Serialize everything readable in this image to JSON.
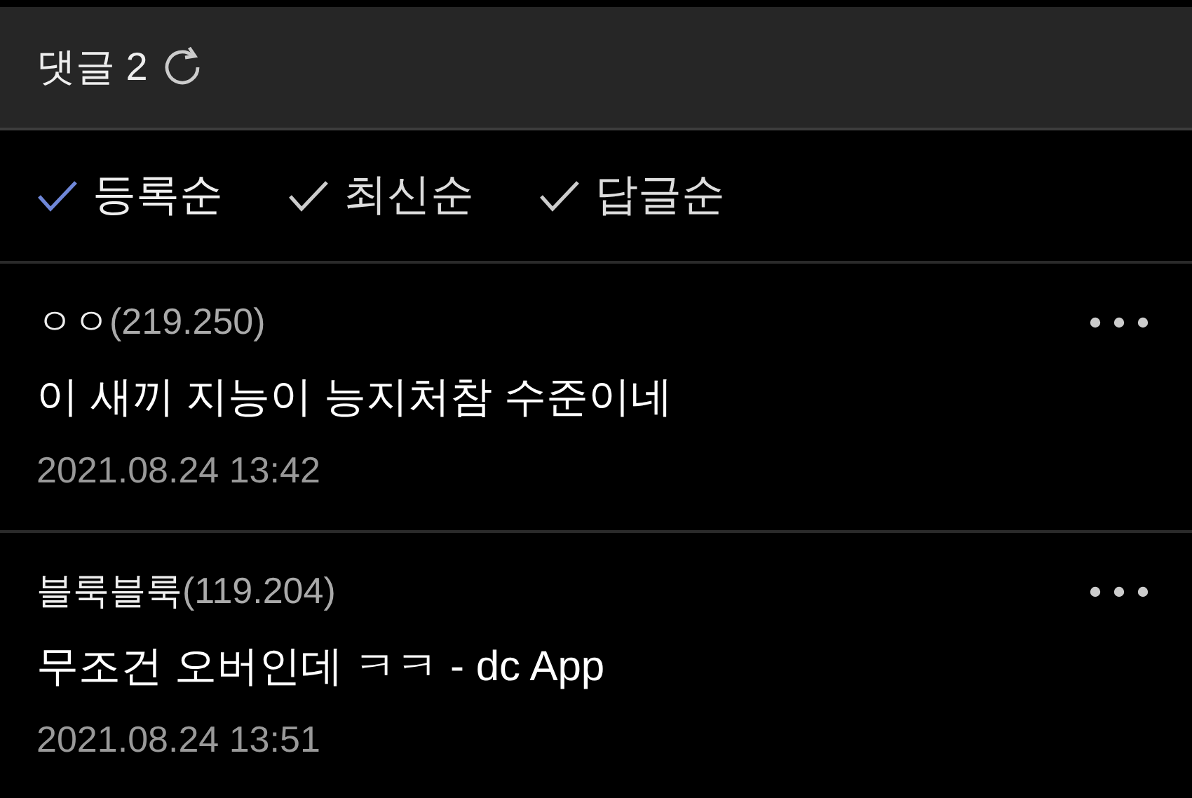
{
  "header": {
    "title": "댓글 2"
  },
  "sort_options": [
    {
      "label": "등록순",
      "selected": true
    },
    {
      "label": "최신순",
      "selected": false
    },
    {
      "label": "답글순",
      "selected": false
    }
  ],
  "comments": [
    {
      "author": "ㅇㅇ",
      "ip": "(219.250)",
      "text": "이 새끼 지능이 능지처참 수준이네",
      "date": "2021.08.24 13:42"
    },
    {
      "author": "블룩블룩",
      "ip": "(119.204)",
      "text": "무조건 오버인데 ㅋㅋ - dc App",
      "date": "2021.08.24 13:51"
    }
  ]
}
